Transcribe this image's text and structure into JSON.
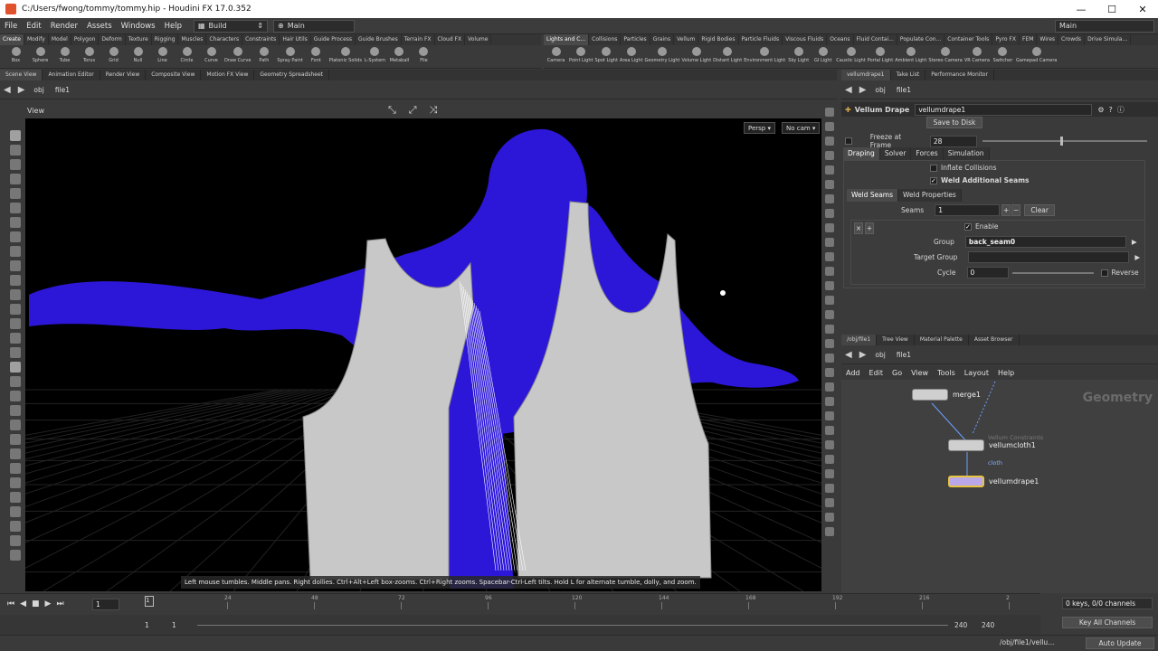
{
  "window": {
    "title": "C:/Users/fwong/tommy/tommy.hip - Houdini FX 17.0.352",
    "controls": [
      "—",
      "☐",
      "✕"
    ]
  },
  "menu": {
    "items": [
      "File",
      "Edit",
      "Render",
      "Assets",
      "Windows",
      "Help"
    ],
    "desktop_label": "Build",
    "shelfset_label": "Main",
    "right_desktop": "Main"
  },
  "shelf_tabs_left": [
    "Create",
    "Modify",
    "Model",
    "Polygon",
    "Deform",
    "Texture",
    "Rigging",
    "Muscles",
    "Characters",
    "Constraints",
    "Hair Utils",
    "Guide Process",
    "Guide Brushes",
    "Terrain FX",
    "Cloud FX",
    "Volume"
  ],
  "shelf_tools_left": [
    "Box",
    "Sphere",
    "Tube",
    "Torus",
    "Grid",
    "Null",
    "Line",
    "Circle",
    "Curve",
    "Draw Curve",
    "Path",
    "Spray Paint",
    "Font",
    "Platonic Solids",
    "L-System",
    "Metaball",
    "File"
  ],
  "shelf_tabs_right": [
    "Lights and C...",
    "Collisions",
    "Particles",
    "Grains",
    "Vellum",
    "Rigid Bodies",
    "Particle Fluids",
    "Viscous Fluids",
    "Oceans",
    "Fluid Contai...",
    "Populate Con...",
    "Container Tools",
    "Pyro FX",
    "FEM",
    "Wires",
    "Crowds",
    "Drive Simula..."
  ],
  "shelf_tools_right": [
    "Camera",
    "Point Light",
    "Spot Light",
    "Area Light",
    "Geometry Light",
    "Volume Light",
    "Distant Light",
    "Environment Light",
    "Sky Light",
    "GI Light",
    "Caustic Light",
    "Portal Light",
    "Ambient Light",
    "Stereo Camera",
    "VR Camera",
    "Switcher",
    "Gamepad Camera"
  ],
  "pane_tabs_left": [
    "Scene View",
    "Animation Editor",
    "Render View",
    "Composite View",
    "Motion FX View",
    "Geometry Spreadsheet"
  ],
  "pane_tabs_right": [
    "vellumdrape1",
    "Take List",
    "Performance Monitor"
  ],
  "path_left": {
    "context": "obj",
    "node": "file1"
  },
  "path_right": {
    "context": "obj",
    "node": "file1"
  },
  "viewport": {
    "label": "View",
    "persp": "Persp ▾",
    "cam": "No cam ▾",
    "status": "Left mouse tumbles. Middle pans. Right dollies. Ctrl+Alt+Left box-zooms. Ctrl+Right zooms. Spacebar-Ctrl-Left tilts. Hold L for alternate tumble, dolly, and zoom.",
    "colors": {
      "body": "#2c17d8",
      "cloth": "#c8c8c8",
      "cloth_lines": "#8a8a8a",
      "points": "#5fd0b8"
    }
  },
  "params": {
    "node_type": "Vellum Drape",
    "node_name": "vellumdrape1",
    "save_button": "Save to Disk",
    "freeze_label": "Freeze at Frame",
    "freeze_value": "28",
    "tabs": [
      "Draping",
      "Solver",
      "Forces",
      "Simulation"
    ],
    "inflate_label": "Inflate Collisions",
    "weld_label": "Weld Additional Seams",
    "weld_tabs": [
      "Weld Seams",
      "Weld Properties"
    ],
    "seams_label": "Seams",
    "seams_value": "1",
    "clear_label": "Clear",
    "enable_label": "Enable",
    "group_label": "Group",
    "group_value": "back_seam0",
    "target_group_label": "Target Group",
    "target_group_value": "",
    "cycle_label": "Cycle",
    "cycle_value": "0",
    "reverse_label": "Reverse"
  },
  "network_tabs": [
    "/obj/file1",
    "Tree View",
    "Material Palette",
    "Asset Browser"
  ],
  "network_menu": [
    "Add",
    "Edit",
    "Go",
    "View",
    "Tools",
    "Layout",
    "Help"
  ],
  "network": {
    "context_label": "Geometry",
    "nodes": [
      {
        "name": "merge1",
        "sub": ""
      },
      {
        "name": "vellumcloth1",
        "sub": "cloth",
        "tag": "Vellum Constraints"
      },
      {
        "name": "vellumdrape1",
        "sub": ""
      }
    ]
  },
  "timeline": {
    "ticks": [
      "24",
      "48",
      "72",
      "96",
      "120",
      "144",
      "168",
      "192",
      "216",
      "2"
    ],
    "current_frame": "1",
    "range_start": "1",
    "range_start2": "1",
    "range_end": "240",
    "range_end2": "240"
  },
  "keys": {
    "status": "0 keys, 0/0 channels",
    "key_all": "Key All Channels"
  },
  "bottom": {
    "path": "/obj/file1/vellu...",
    "update_mode": "Auto Update"
  }
}
